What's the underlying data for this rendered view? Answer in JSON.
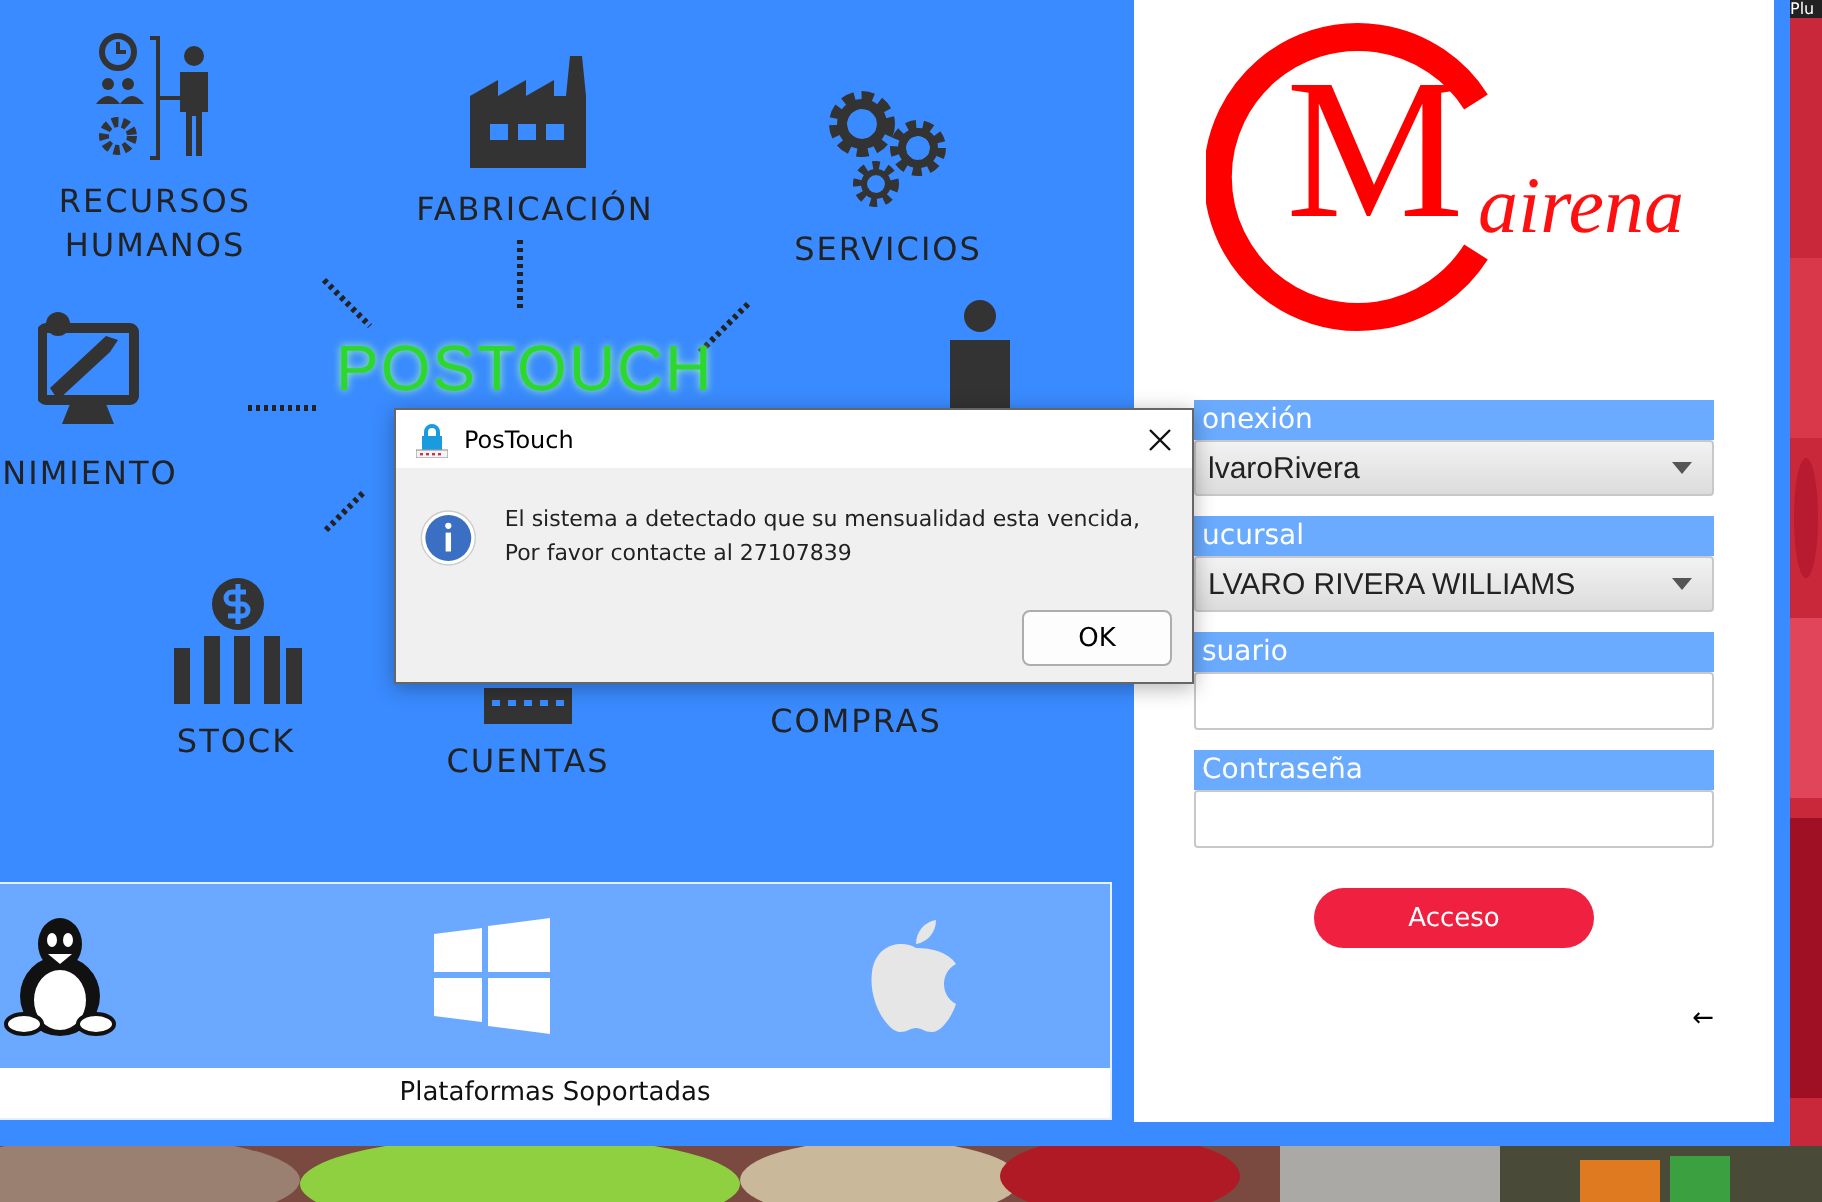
{
  "corner_text": "Plu",
  "diagram": {
    "center": "POSTOUCH",
    "nodes": [
      {
        "kind": "hr",
        "label": "RECURSOS HUMANOS"
      },
      {
        "kind": "factory",
        "label": "FABRICACIÓN"
      },
      {
        "kind": "gears",
        "label": "SERVICIOS"
      },
      {
        "kind": "maintenance",
        "label": "NIMIENTO"
      },
      {
        "kind": "person"
      },
      {
        "kind": "stock",
        "label": "STOCK"
      },
      {
        "kind": "accounts",
        "label": "CUENTAS"
      },
      {
        "kind": "purchases",
        "label": "COMPRAS"
      }
    ]
  },
  "platforms": {
    "items": [
      {
        "kind": "linux"
      },
      {
        "kind": "windows"
      },
      {
        "kind": "apple"
      }
    ],
    "caption": "Plataformas Soportadas"
  },
  "logo": {
    "letter": "M",
    "text": "airena"
  },
  "login": {
    "fields": [
      {
        "kind": "select",
        "label": "onexión",
        "value": "lvaroRivera"
      },
      {
        "kind": "select",
        "label": "ucursal",
        "value": "LVARO RIVERA WILLIAMS"
      },
      {
        "kind": "input",
        "label": "suario"
      },
      {
        "kind": "input",
        "label": "Contraseña"
      }
    ],
    "submit": "Acceso",
    "back": "←"
  },
  "dialog": {
    "title": "PosTouch",
    "message": "El sistema a detectado que su mensualidad esta vencida, Por favor contacte al 27107839",
    "button": "OK"
  }
}
